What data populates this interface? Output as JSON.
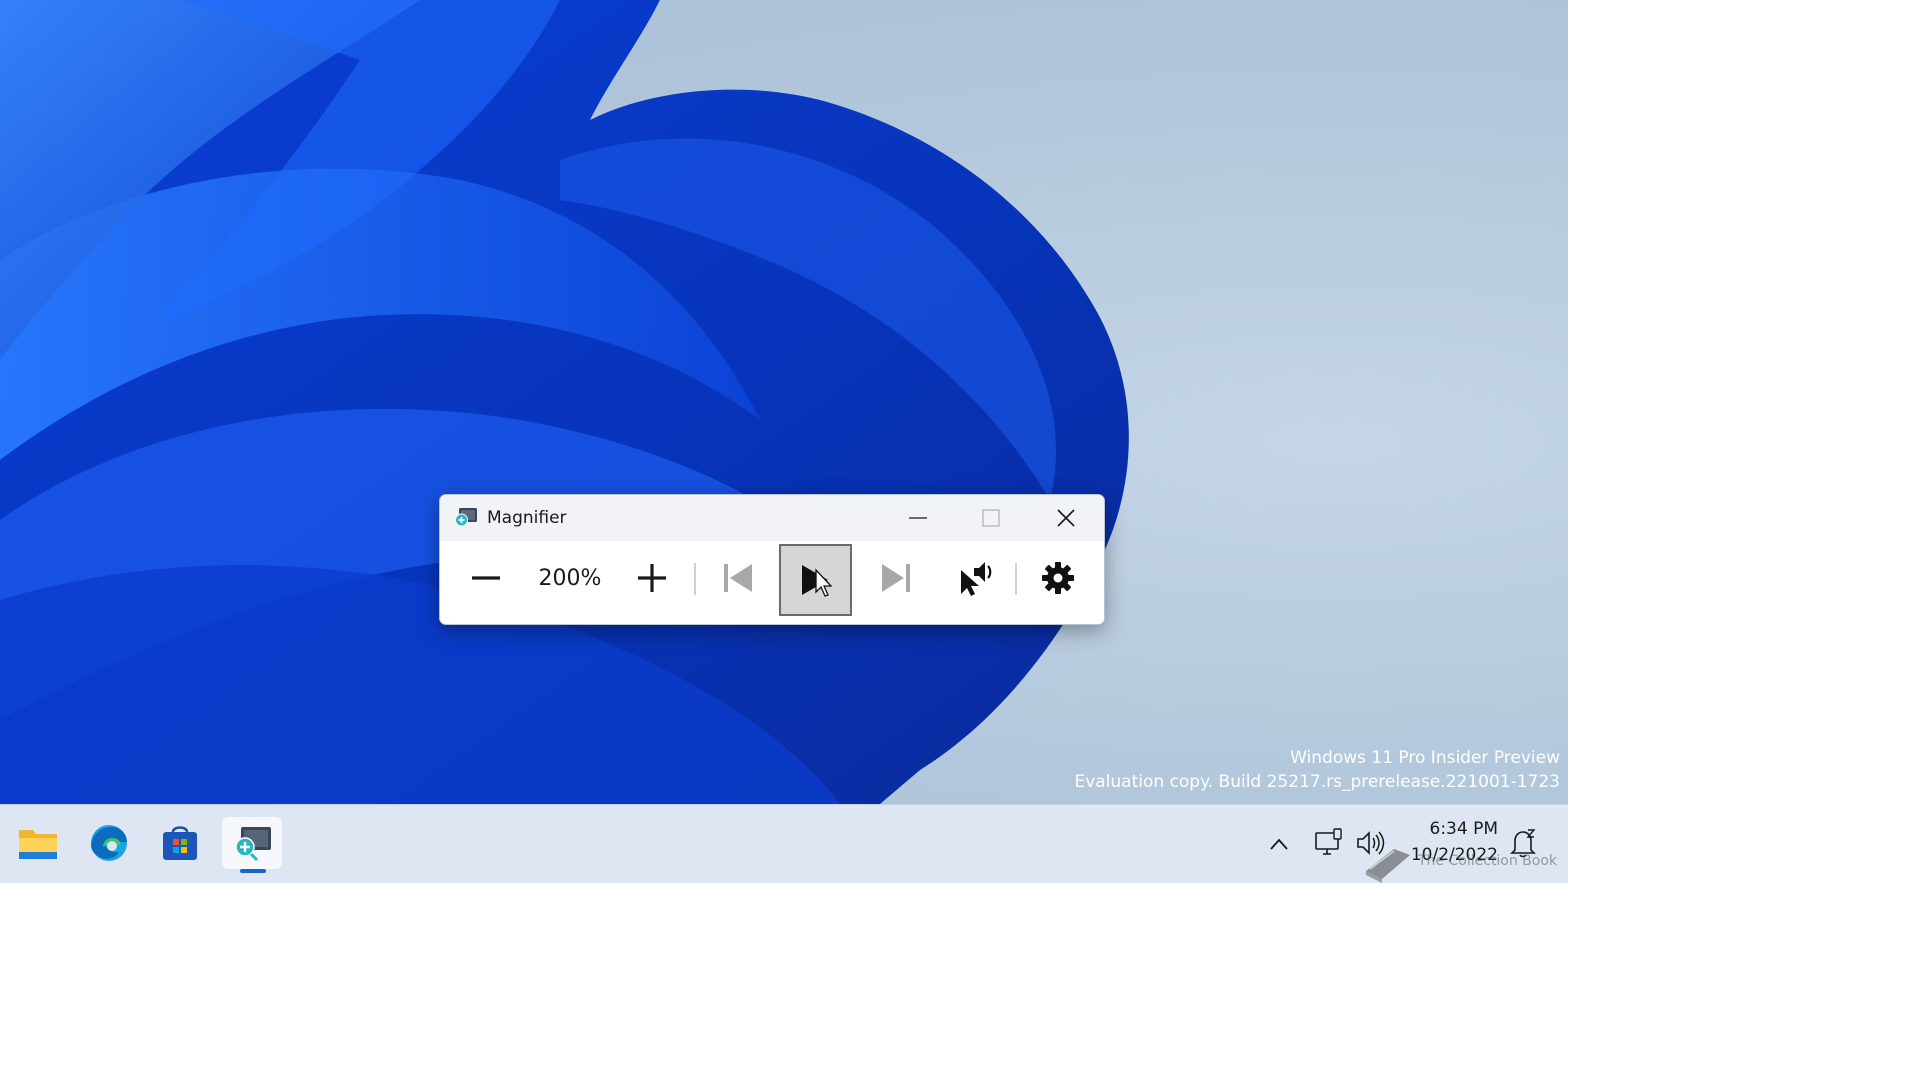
{
  "desktop": {
    "watermark_line1": "Windows 11 Pro Insider Preview",
    "watermark_line2": "Evaluation copy. Build 25217.rs_prerelease.221001-1723"
  },
  "magnifier": {
    "title": "Magnifier",
    "icon": "magnifier-app-icon",
    "caption_buttons": [
      "minimize-icon",
      "maximize-icon",
      "close-icon"
    ],
    "toolbar": {
      "zoom_out_icon": "minus-icon",
      "zoom_level": "200%",
      "zoom_in_icon": "plus-icon",
      "previous_icon": "skip-previous-icon",
      "play_icon": "play-icon",
      "play_state": "pressed",
      "next_icon": "skip-next-icon",
      "read_from_pointer_icon": "pointer-speaker-icon",
      "settings_icon": "gear-icon"
    }
  },
  "taskbar": {
    "apps": [
      {
        "name": "File Explorer",
        "icon": "folder-icon"
      },
      {
        "name": "Microsoft Edge",
        "icon": "edge-icon"
      },
      {
        "name": "Microsoft Store",
        "icon": "store-icon"
      },
      {
        "name": "Magnifier",
        "icon": "magnifier-icon",
        "active": true
      }
    ],
    "tray": {
      "chevron_icon": "chevron-up-icon",
      "network_icon": "network-icon",
      "volume_icon": "volume-icon",
      "time": "6:34 PM",
      "date": "10/2/2022",
      "notification_icon": "notification-icon"
    },
    "overlay_logo_text": "The Collection Book"
  },
  "colors": {
    "accent": "#1a64c8",
    "taskbar": "#dde6f2",
    "titlebar": "#f1f3f7",
    "pressed_button": "#d6d6d6"
  }
}
